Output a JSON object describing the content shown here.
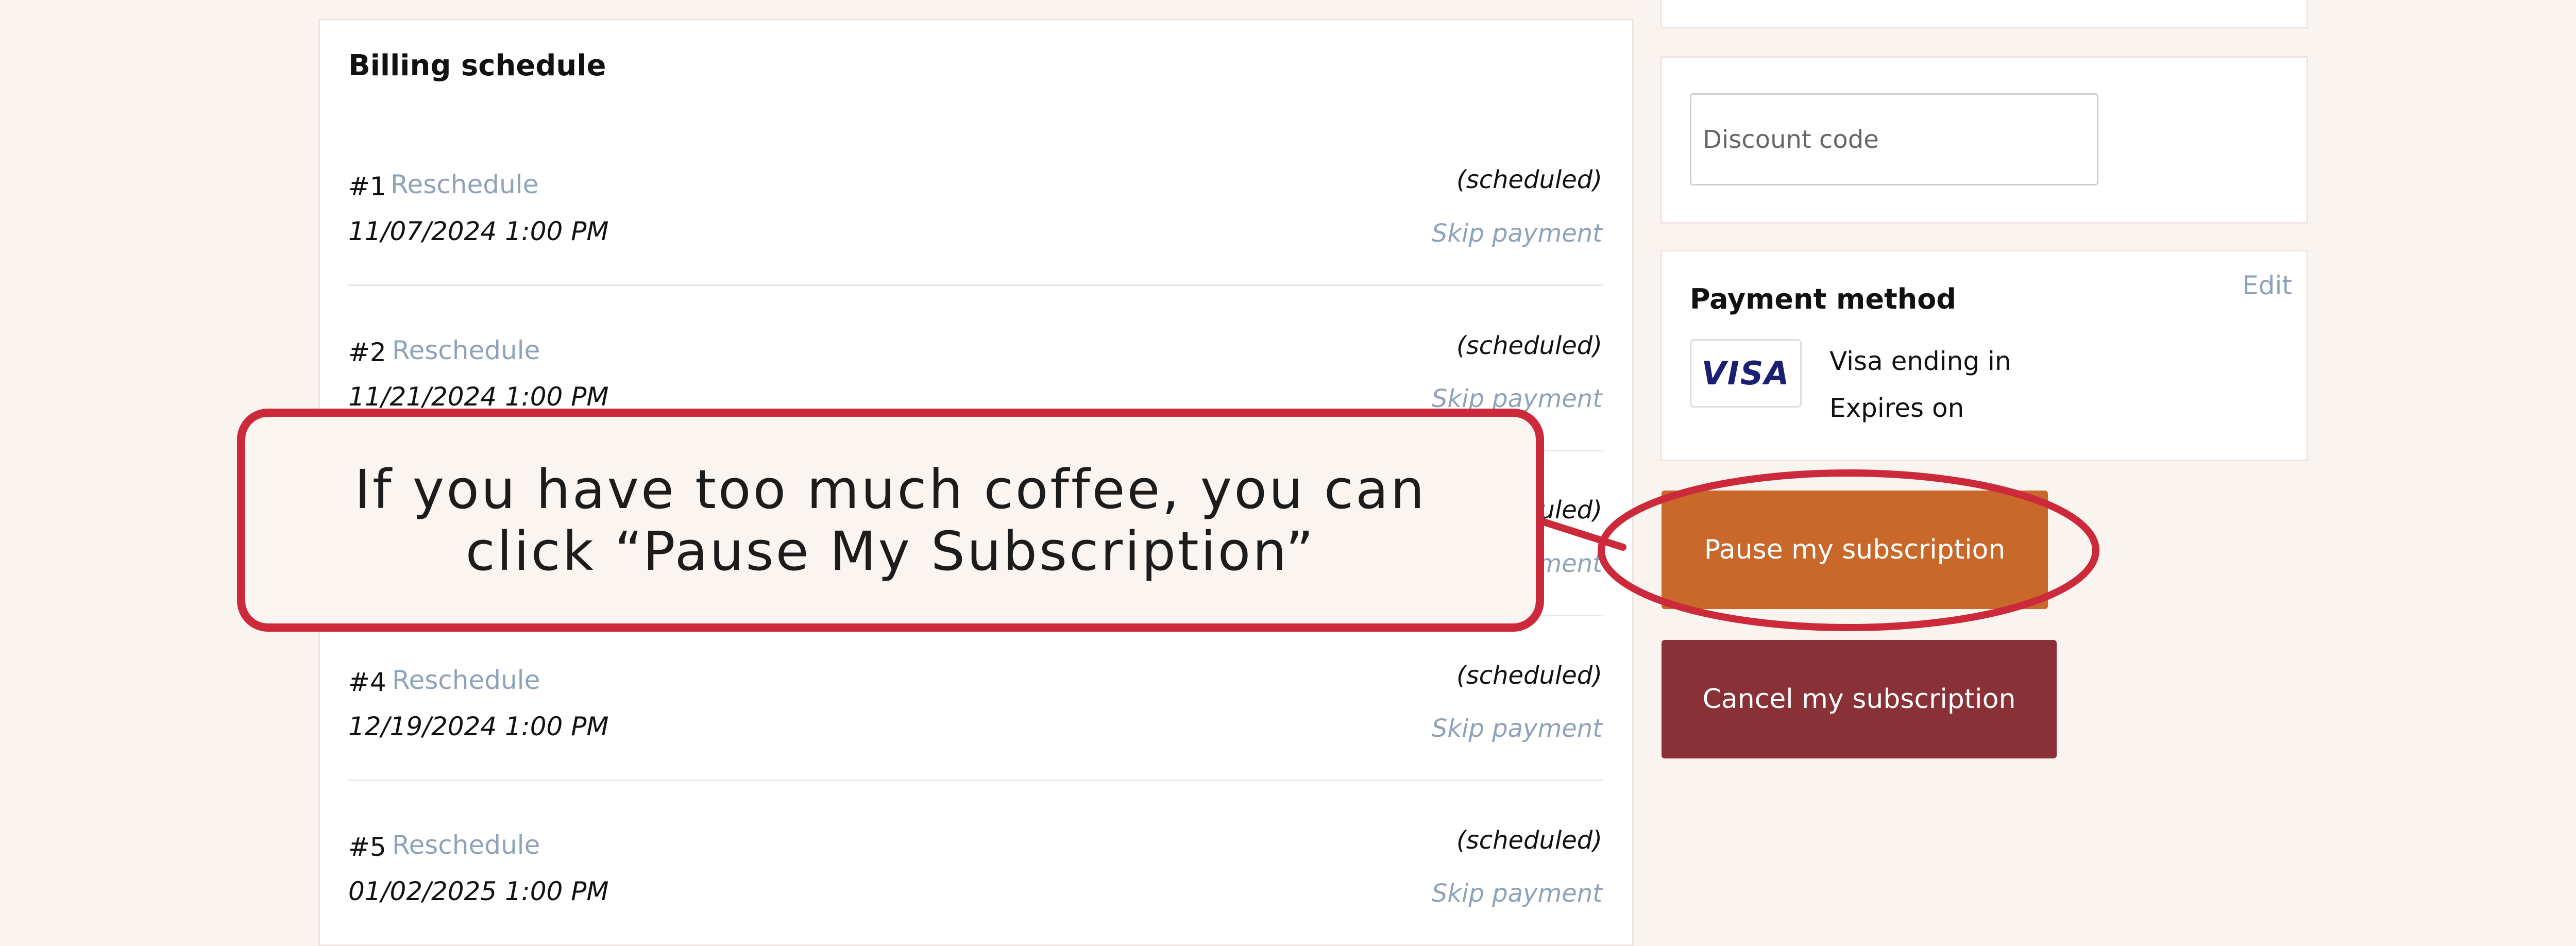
{
  "billing": {
    "title": "Billing schedule",
    "reschedule_label": "Reschedule",
    "skip_label": "Skip payment",
    "payments": [
      {
        "number": "#1",
        "date": "11/07/2024 1:00 PM",
        "status": "(scheduled)"
      },
      {
        "number": "#2",
        "date": "11/21/2024 1:00 PM",
        "status": "(scheduled)"
      },
      {
        "number": "#4",
        "date": "12/19/2024 1:00 PM",
        "status": "(scheduled)"
      },
      {
        "number": "#5",
        "date": "01/02/2025 1:00 PM",
        "status": "(scheduled)"
      }
    ],
    "partial_row": {
      "status_fragment": "uled)",
      "skip_fragment": "ment"
    }
  },
  "discount": {
    "placeholder": "Discount code"
  },
  "payment_method": {
    "title": "Payment method",
    "edit_label": "Edit",
    "card_brand": "VISA",
    "card_line": "Visa ending in",
    "expires_line": "Expires on"
  },
  "actions": {
    "pause_label": "Pause my subscription",
    "cancel_label": "Cancel my subscription"
  },
  "annotation": {
    "text": "If you have too much coffee, you can click “Pause My Subscription”",
    "accent_color": "#cc2a3a"
  },
  "colors": {
    "background": "#faf4f1",
    "link": "#8ea3ba",
    "pause_button": "#c8682a",
    "cancel_button": "#8a3037",
    "visa_blue": "#1a1f71"
  }
}
